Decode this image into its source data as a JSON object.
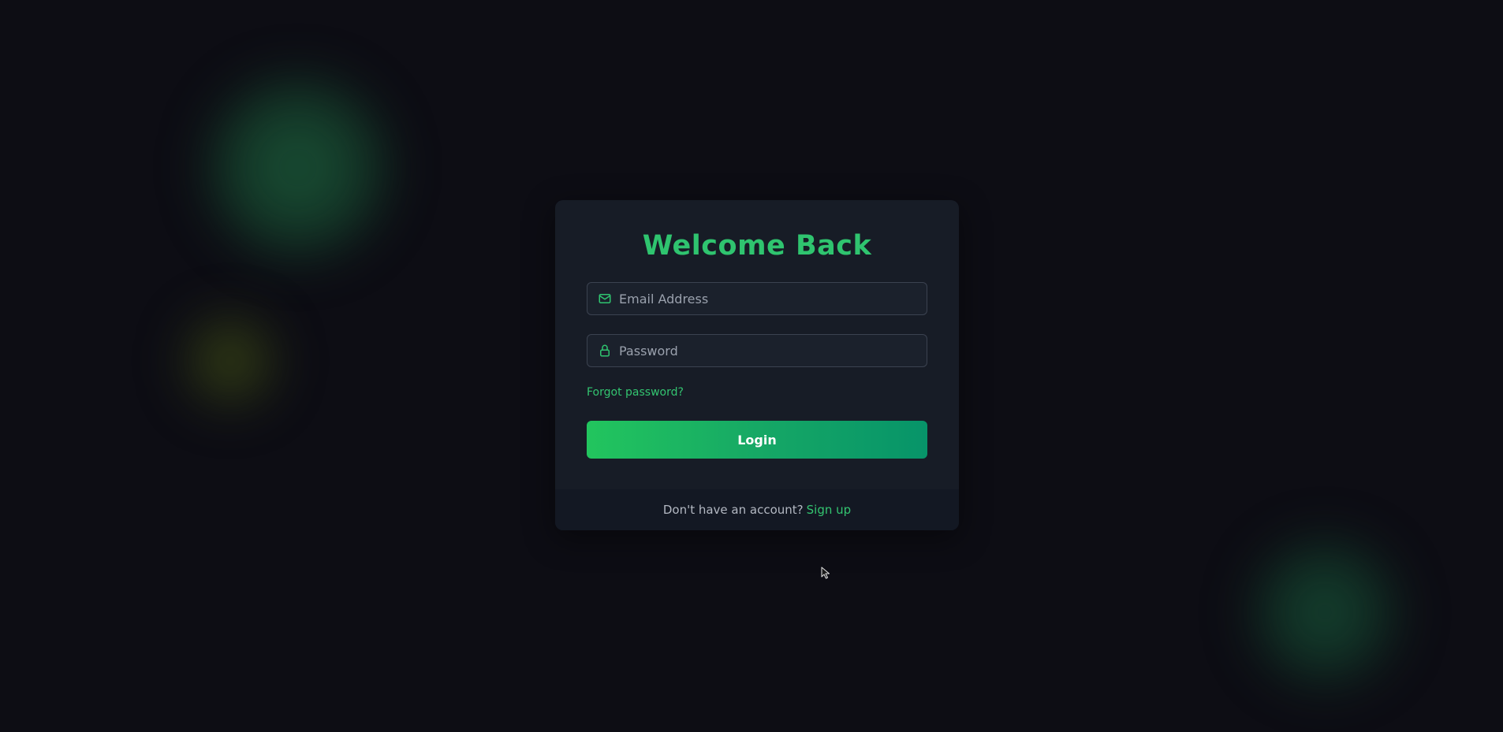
{
  "colors": {
    "background": "#0d0d14",
    "card": "#171c26",
    "card_footer": "#131823",
    "accent": "#2fc46f",
    "button_start": "#22c55e",
    "button_end": "#079469"
  },
  "login": {
    "title": "Welcome Back",
    "email": {
      "icon": "mail-icon",
      "placeholder": "Email Address",
      "value": ""
    },
    "password": {
      "icon": "lock-icon",
      "placeholder": "Password",
      "value": ""
    },
    "forgot_label": "Forgot password?",
    "submit_label": "Login",
    "footer": {
      "prompt": "Don't have an account?",
      "signup_label": "Sign up"
    }
  }
}
